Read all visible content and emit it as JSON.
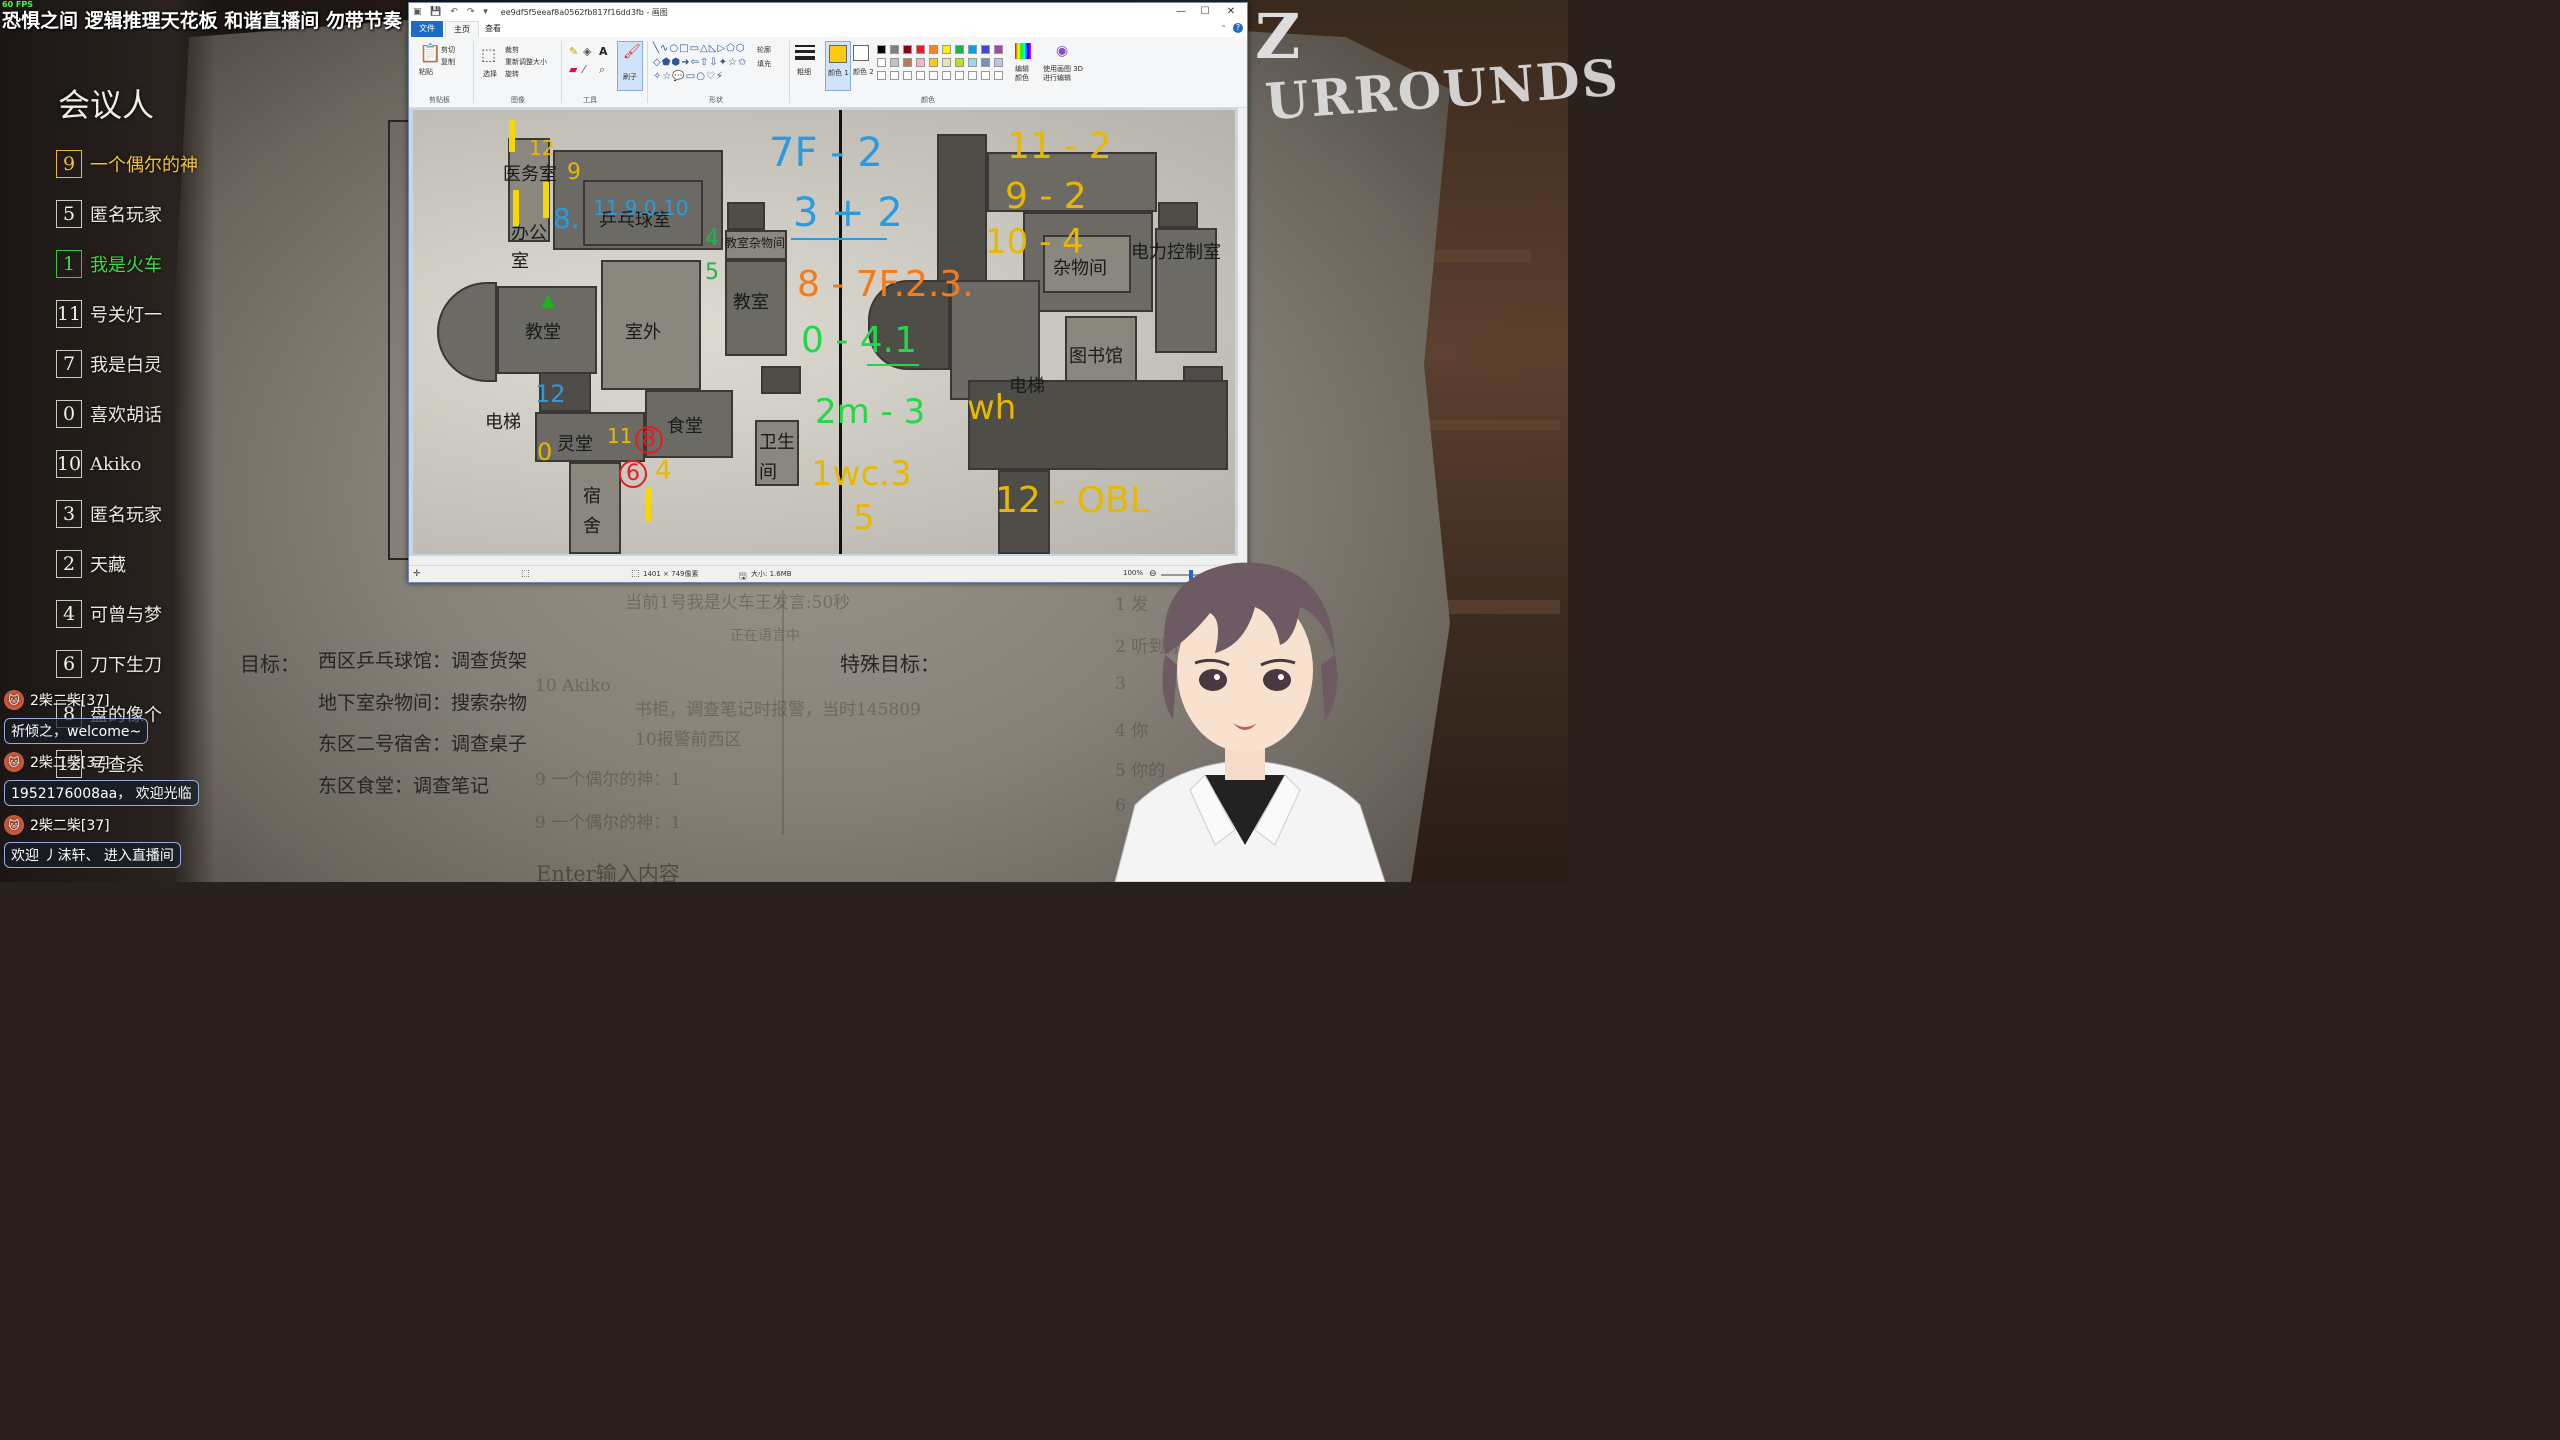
{
  "overlay": {
    "fps": "60 FPS",
    "stream_title": "恐惧之间 逻辑推理天花板 和谐直播间 勿带节奏",
    "meeting_title": "会议人",
    "enter_placeholder": "Enter输入内容",
    "logo_text": "URROUNDS"
  },
  "players": [
    {
      "num": "9",
      "name": "一个偶尔的神",
      "style": "gold"
    },
    {
      "num": "5",
      "name": "匿名玩家",
      "style": "normal"
    },
    {
      "num": "1",
      "name": "我是火车",
      "style": "green"
    },
    {
      "num": "11",
      "name": "号关灯一",
      "style": "normal"
    },
    {
      "num": "7",
      "name": "我是白灵",
      "style": "normal"
    },
    {
      "num": "0",
      "name": "喜欢胡话",
      "style": "normal"
    },
    {
      "num": "10",
      "name": "Akiko",
      "style": "normal"
    },
    {
      "num": "3",
      "name": "匿名玩家",
      "style": "normal"
    },
    {
      "num": "2",
      "name": "天藏",
      "style": "normal"
    },
    {
      "num": "4",
      "name": "可曾与梦",
      "style": "normal"
    },
    {
      "num": "6",
      "name": "刀下生刀",
      "style": "normal"
    },
    {
      "num": "8",
      "name": "盘的像个",
      "style": "normal"
    },
    {
      "num": "12",
      "name": "号查杀",
      "style": "normal"
    }
  ],
  "chat": [
    {
      "user": "2柴二柴[37]",
      "message": "祈倾之，welcome~"
    },
    {
      "user": "2柴二柴[37]",
      "message": "1952176008aa， 欢迎光临"
    },
    {
      "user": "2柴二柴[37]",
      "message": "欢迎 丿沫轩、 进入直播间"
    }
  ],
  "objectives": {
    "label": "目标：",
    "items": [
      "西区乒乓球馆：调查货架",
      "地下室杂物间：搜索杂物",
      "东区二号宿舍：调查桌子",
      "东区食堂：调查笔记"
    ],
    "special_label": "特殊目标："
  },
  "faint_texts": {
    "speech": "当前1号我是火车王发言:50秒",
    "speaking": "正在语言中",
    "log1": "书柜，调查笔记时报警，当时145809",
    "log2": "10报警前西区",
    "log3": "9 一个偶尔的神：1",
    "log4": "9 一个偶尔的神：1",
    "log_akiko": "10 Akiko",
    "right1": "1 发",
    "right2": "2 听到你说话呢",
    "right3": "3",
    "right4": "4 你",
    "right5": "5 你的",
    "right6": "6"
  },
  "paint": {
    "window_title": "ee9df5f5eeaf8a0562fb817f16dd3fb - 画图",
    "tabs": [
      "文件",
      "主页",
      "查看"
    ],
    "groups": {
      "clipboard": "剪贴板",
      "image": "图像",
      "tools": "工具",
      "shapes": "形状",
      "colors": "颜色"
    },
    "ribbon": {
      "paste": "粘贴",
      "cut": "剪切",
      "copy": "复制",
      "select": "选择",
      "crop": "裁剪",
      "resize": "重新调整大小",
      "rotate": "旋转",
      "brush": "刷子",
      "outline": "轮廓",
      "fill": "填充",
      "size": "粗细",
      "color1": "颜色 1",
      "color2": "颜色 2",
      "edit_colors": "编辑颜色",
      "paint3d": "使用画图 3D 进行编辑"
    },
    "status": {
      "dimensions": "1401 × 749像素",
      "filesize": "大小: 1.6MB",
      "zoom": "100%"
    },
    "palette": [
      "#000000",
      "#7f7f7f",
      "#880015",
      "#ed1c24",
      "#ff7f27",
      "#fff200",
      "#22b14c",
      "#00a2e8",
      "#3f48cc",
      "#a349a4",
      "#ffffff",
      "#c3c3c3",
      "#b97a57",
      "#ffaec9",
      "#ffc90e",
      "#efe4b0",
      "#b5e61d",
      "#99d9ea",
      "#7092be",
      "#c8bfe7"
    ],
    "color1_hex": "#ffc90e",
    "color2_hex": "#ffffff"
  },
  "map": {
    "labels": {
      "infirmary": "医务室",
      "office": "办公室",
      "pingpong": "乒乓球室",
      "basement_storage": "教室杂物间",
      "classroom_left": "教堂",
      "outdoor": "室外",
      "classroom_right": "教室",
      "elevator_left": "电梯",
      "spirit_hall": "灵堂",
      "canteen": "食堂",
      "toilet": "卫生间",
      "dorm": "宿舍",
      "storage_east": "杂物间",
      "power_room": "电力控制室",
      "library": "图书馆",
      "elevator_right": "电梯"
    },
    "annotations": {
      "a_12": "12",
      "a_9": "9",
      "a_8": "8.",
      "a_11910": "11.9.0.10",
      "a_4": "4",
      "a_5": "5",
      "a_12b": "12",
      "a_0": "0",
      "a_11": "11",
      "a_8c": "8",
      "a_6": "6",
      "a_4b": "4",
      "r_7f2": "7F - 2",
      "r_3p2": "3 + 2",
      "r_8_7f": "8 - 7F.2.3.",
      "r_0_41": "0 - 4.1",
      "r_2m3": "2m - 3",
      "r_wh": "wh",
      "r_1wc": "1wc.3",
      "r_5": "5",
      "r_112": "11 - 2",
      "r_92": "9 - 2",
      "r_104": "10 - 4",
      "r_12obl": "12 - OBL"
    }
  }
}
